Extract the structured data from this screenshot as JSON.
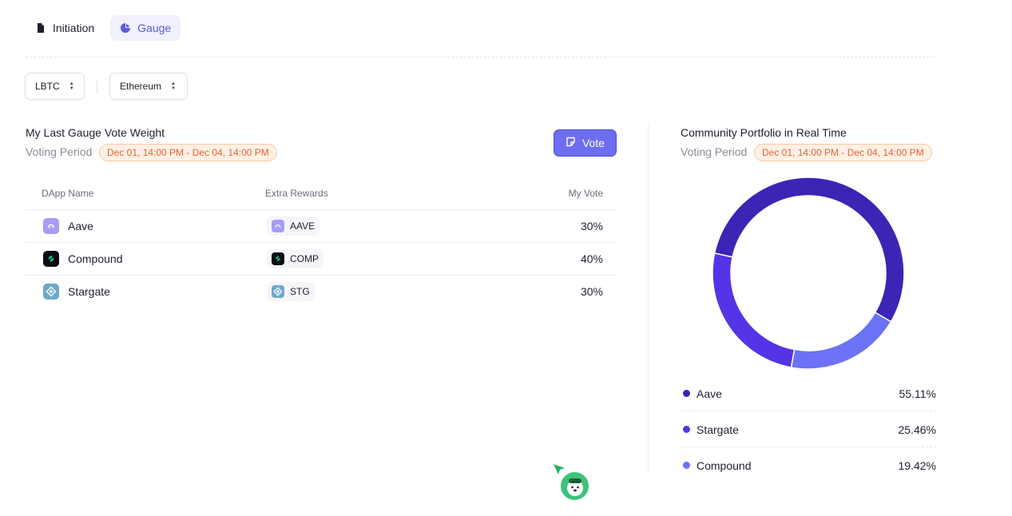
{
  "tabs": [
    {
      "label": "Initiation",
      "icon": "file-icon",
      "active": false
    },
    {
      "label": "Gauge",
      "icon": "pie-chart-icon",
      "active": true
    }
  ],
  "filters": {
    "token": "LBTC",
    "network": "Ethereum"
  },
  "my_vote": {
    "title": "My Last Gauge Vote Weight",
    "period_label": "Voting Period",
    "period_range": "Dec 01, 14:00 PM - Dec 04, 14:00 PM",
    "vote_button": "Vote",
    "columns": [
      "DApp Name",
      "Extra Rewards",
      "My Vote"
    ],
    "rows": [
      {
        "name": "Aave",
        "reward": "AAVE",
        "vote": "30%",
        "color": "#a79cf5"
      },
      {
        "name": "Compound",
        "reward": "COMP",
        "vote": "40%",
        "color": "#0b0b12"
      },
      {
        "name": "Stargate",
        "reward": "STG",
        "vote": "30%",
        "color": "#6fa8c9"
      }
    ]
  },
  "community": {
    "title": "Community Portfolio in Real Time",
    "period_label": "Voting Period",
    "period_range": "Dec 01, 14:00 PM - Dec 04, 14:00 PM",
    "legend": [
      {
        "name": "Aave",
        "value": "55.11%",
        "color": "#3a25b5"
      },
      {
        "name": "Stargate",
        "value": "25.46%",
        "color": "#5534e8"
      },
      {
        "name": "Compound",
        "value": "19.42%",
        "color": "#6b72f5"
      }
    ]
  },
  "chart_data": {
    "type": "pie",
    "categories": [
      "Aave",
      "Stargate",
      "Compound"
    ],
    "values": [
      55.11,
      25.46,
      19.42
    ],
    "colors": [
      "#3a25b5",
      "#5534e8",
      "#6b72f5"
    ]
  }
}
